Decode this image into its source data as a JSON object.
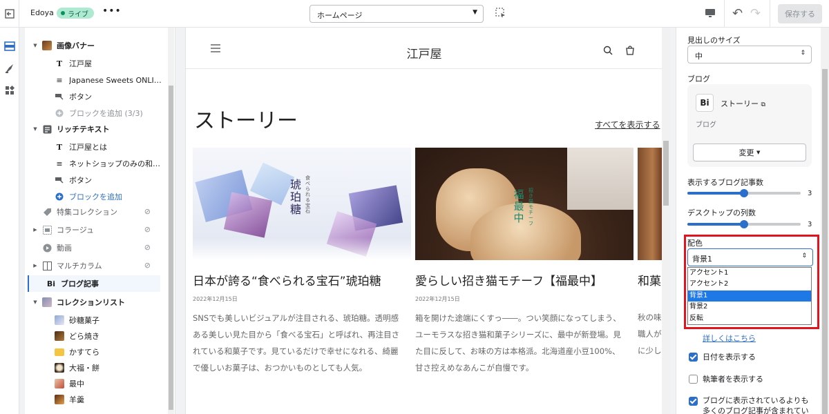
{
  "topbar": {
    "theme_name": "Edoya",
    "live_label": "ライブ",
    "more_label": "•••",
    "page_select": "ホームページ",
    "save_label": "保存する"
  },
  "sidebar": {
    "rows": [
      {
        "label": "画像バナー",
        "kind": "section",
        "caret": "▼"
      },
      {
        "label": "江戸屋",
        "kind": "child"
      },
      {
        "label": "Japanese Sweets ONLINE S...",
        "kind": "child"
      },
      {
        "label": "ボタン",
        "kind": "child"
      },
      {
        "label": "ブロックを追加 (3/3)",
        "kind": "child"
      },
      {
        "label": "リッチテキスト",
        "kind": "section",
        "caret": "▼"
      },
      {
        "label": "江戸屋とは",
        "kind": "child"
      },
      {
        "label": "ネットショップのみの和菓...",
        "kind": "child"
      },
      {
        "label": "ボタン",
        "kind": "child"
      },
      {
        "label": "ブロックを追加",
        "kind": "child"
      },
      {
        "label": "特集コレクション",
        "kind": "section"
      },
      {
        "label": "コラージュ",
        "kind": "section",
        "caret": "▶"
      },
      {
        "label": "動画",
        "kind": "section"
      },
      {
        "label": "マルチカラム",
        "kind": "section",
        "caret": "▶"
      },
      {
        "label": "ブログ記事",
        "kind": "section"
      },
      {
        "label": "コレクションリスト",
        "kind": "section",
        "caret": "▼"
      },
      {
        "label": "砂糖菓子",
        "kind": "child"
      },
      {
        "label": "どら焼き",
        "kind": "child"
      },
      {
        "label": "かすてら",
        "kind": "child"
      },
      {
        "label": "大福・餅",
        "kind": "child"
      },
      {
        "label": "最中",
        "kind": "child"
      },
      {
        "label": "羊羹",
        "kind": "child"
      }
    ]
  },
  "preview": {
    "logo": "江戸屋",
    "section_title": "ストーリー",
    "view_all": "すべてを表示する",
    "cards": [
      {
        "image_text": "琥珀糖",
        "image_subtext": "食べられる宝石",
        "title": "日本が誇る“食べられる宝石”琥珀糖",
        "date": "2022年12月15日",
        "body": [
          "SNSでも美しいビジュアルが注目される、琥珀糖。透明感",
          "ある美しい見た目から「食べる宝石」と呼ばれ、再注目さ",
          "れている和菓子です。見ているだけで幸せになれる、綺麗",
          "で優しいお菓子は、おつかいものとしても人気。"
        ]
      },
      {
        "image_text": "福最中",
        "image_subtext": "招き猫モチーフ",
        "title": "愛らしい招き猫モチーフ【福最中】",
        "date": "2022年12月15日",
        "body": [
          "箱を開けた途端にくすっ――。つい笑顔になってしまう、",
          "ユーモラスな招き猫和菓子シリーズに、最中が新登場。見",
          "た目に反して、お味の方は本格派。北海道産小豆100%、",
          "甘さ控えめなあんこが自慢です。"
        ]
      },
      {
        "title": "和菓",
        "body": [
          "秋の味",
          "職人が",
          "に少し"
        ]
      }
    ]
  },
  "settings": {
    "heading_size_label": "見出しのサイズ",
    "heading_size_value": "中",
    "blog_label": "ブログ",
    "blog_name": "ストーリー",
    "blog_sub": "ブログ",
    "change_label": "変更",
    "posts_label": "表示するブログ記事数",
    "posts_value": "3",
    "posts_level": 0.5,
    "columns_label": "デスクトップの列数",
    "columns_value": "3",
    "columns_level": 0.5,
    "scheme_label": "配色",
    "scheme_value": "背景1",
    "scheme_options": [
      "アクセント1",
      "アクセント2",
      "背景1",
      "背景2",
      "反転"
    ],
    "learn_more": "詳しくはこちら",
    "show_date": "日付を表示する",
    "show_author": "執筆者を表示する",
    "show_more": "ブログに表示されているよりも多くのブログ記事が含まれている場"
  }
}
